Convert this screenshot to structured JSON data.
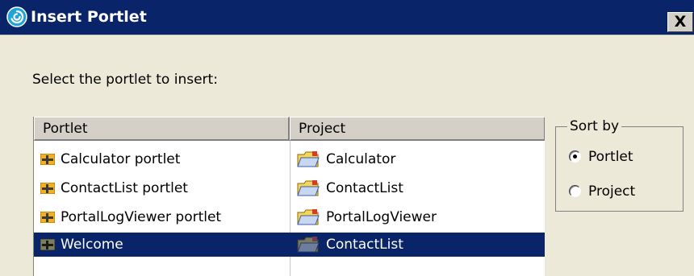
{
  "window": {
    "title": "Insert Portlet",
    "close_label": "X",
    "icon": "swirl-icon"
  },
  "prompt": "Select the portlet to insert:",
  "table": {
    "columns": [
      "Portlet",
      "Project"
    ],
    "rows": [
      {
        "portlet": "Calculator portlet",
        "project": "Calculator",
        "selected": false
      },
      {
        "portlet": "ContactList portlet",
        "project": "ContactList",
        "selected": false
      },
      {
        "portlet": "PortalLogViewer portlet",
        "project": "PortalLogViewer",
        "selected": false
      },
      {
        "portlet": "Welcome",
        "project": "ContactList",
        "selected": true
      }
    ],
    "portlet_icon": "portlet-icon",
    "project_icon": "folder-icon"
  },
  "sort_by": {
    "legend": "Sort by",
    "options": [
      "Portlet",
      "Project"
    ],
    "selected": "Portlet"
  },
  "colors": {
    "titlebar": "#0a246a",
    "selection": "#0a246a",
    "dialog_background": "#ece9d8"
  }
}
